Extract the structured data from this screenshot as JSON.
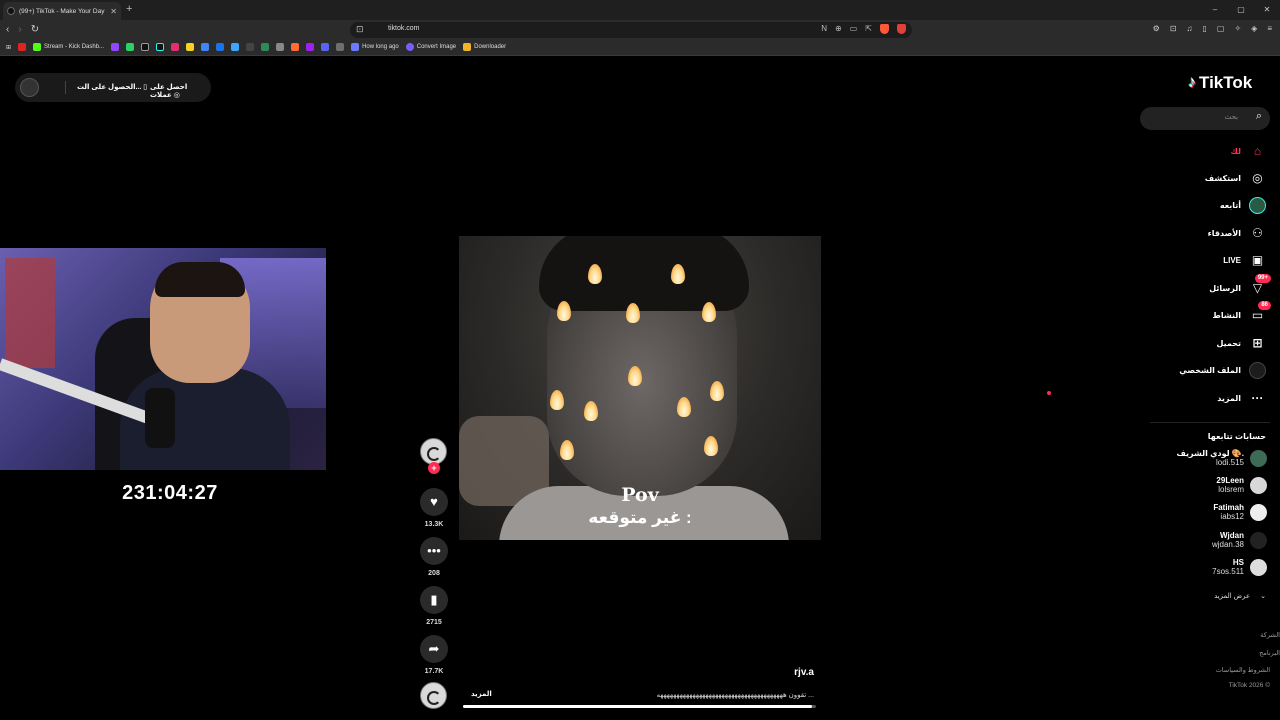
{
  "browser": {
    "tab_title": "(99+) TikTok - Make Your Day",
    "new_tab": "+",
    "url": "tiktok.com",
    "window_controls": [
      "–",
      "▢",
      "✕"
    ],
    "bookmarks": [
      "Stream - Kick Dashb...",
      "How long ago",
      "Convert Image",
      "Downloader"
    ]
  },
  "page": {
    "get_app": {
      "coins_label": "احصل على عملات",
      "app_label": "الحصول على الت..."
    },
    "timer": "231:04:27",
    "video": {
      "caption_line1": "Pov",
      "caption_line2": "غير متوقعه :",
      "author": "rjv.a",
      "description": "تقوون هههههههههههههههههههههههههههههههههههههههه ...",
      "more_label": "المزيد",
      "progress": 0.99
    },
    "actions": {
      "plus": "+",
      "likes": "13.3K",
      "comments": "208",
      "saves": "2715",
      "shares": "17.7K"
    }
  },
  "sidebar": {
    "logo": "TikTok",
    "search_placeholder": "بحث",
    "nav": [
      {
        "label": "لك",
        "icon": "home-icon",
        "glyph": "⌂"
      },
      {
        "label": "استكشف",
        "icon": "compass-icon",
        "glyph": "◎"
      },
      {
        "label": "أتابعه",
        "icon": "following-avatar-icon",
        "glyph": ""
      },
      {
        "label": "الأصدقاء",
        "icon": "friends-icon",
        "glyph": "⚇"
      },
      {
        "label": "LIVE",
        "icon": "live-icon",
        "glyph": "▣"
      },
      {
        "label": "الرسائل",
        "icon": "messages-icon",
        "glyph": "▽",
        "badge": "99+"
      },
      {
        "label": "النشاط",
        "icon": "activity-icon",
        "glyph": "▭",
        "badge": "86"
      },
      {
        "label": "تحميل",
        "icon": "upload-icon",
        "glyph": "⊞"
      },
      {
        "label": "الملف الشخصي",
        "icon": "profile-avatar-icon",
        "glyph": ""
      },
      {
        "label": "المزيد",
        "icon": "more-icon",
        "glyph": "···"
      }
    ],
    "following_title": "حسابات تتابعها",
    "following": [
      {
        "display": "لودي الشريف 🎨.",
        "user": "lodi.515"
      },
      {
        "display": "29Leen",
        "user": "lolsrem"
      },
      {
        "display": "Fatimah",
        "user": "iabs12"
      },
      {
        "display": "Wjdan",
        "user": "wjdan.38"
      },
      {
        "display": "HS",
        "user": "7sos.511"
      }
    ],
    "see_more": "عرض المزيد",
    "footer": [
      "الشركة",
      "البرنامج",
      "الشروط والسياسات",
      "TikTok 2026 ©"
    ]
  },
  "colors": {
    "accent": "#fe2c55",
    "background": "#000000",
    "chrome": "#2b2b2b"
  }
}
